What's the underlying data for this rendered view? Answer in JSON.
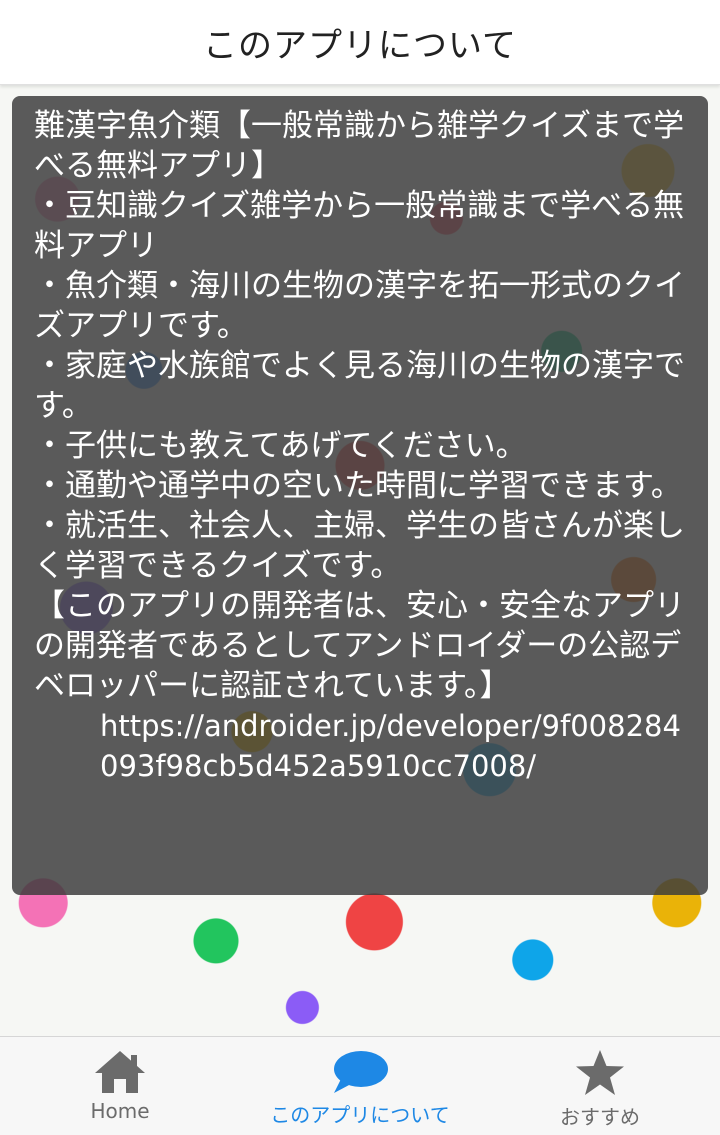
{
  "header": {
    "title": "このアプリについて"
  },
  "content": {
    "paragraphs": [
      "難漢字魚介類【一般常識から雑学クイズまで学べる無料アプリ】",
      "・豆知識クイズ雑学から一般常識まで学べる無料アプリ",
      "・魚介類・海川の生物の漢字を拓一形式のクイズアプリです。",
      "・家庭や水族館でよく見る海川の生物の漢字です。",
      "・子供にも教えてあげてください。",
      "・通勤や通学中の空いた時間に学習できます。",
      "・就活生、社会人、主婦、学生の皆さんが楽しく学習できるクイズです。",
      "【このアプリの開発者は、安心・安全なアプリの開発者であるとしてアンドロイダーの公認デベロッパーに認証されています。】"
    ],
    "url": "https://androider.jp/developer/9f008284093f98cb5d452a5910cc7008/"
  },
  "bottom_nav": {
    "items": [
      {
        "label": "Home",
        "icon": "home-icon",
        "active": false
      },
      {
        "label": "このアプリについて",
        "icon": "speech-bubble-icon",
        "active": true
      },
      {
        "label": "おすすめ",
        "icon": "star-icon",
        "active": false
      }
    ]
  },
  "colors": {
    "accent": "#1e88e5",
    "inactive": "#6b6b6b",
    "overlay": "#3c3c3c"
  }
}
